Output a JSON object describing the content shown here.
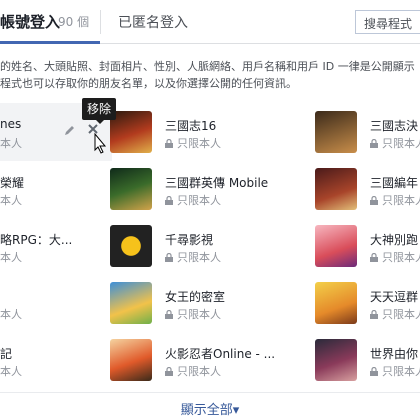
{
  "tabs": {
    "active_label": "帳號登入",
    "active_count": "90 個",
    "anonymous_label": "已匿名登入",
    "search_placeholder": "搜尋程式"
  },
  "description": {
    "line1": "的姓名、大頭貼照、封面相片、性別、人脈網絡、用戶名稱和用戶 ID 一律是公開顯示",
    "line2": "程式也可以存取你的朋友名單，以及你選擇公開的任何資訊。"
  },
  "tooltip": {
    "remove": "移除"
  },
  "apps": [
    {
      "name": "nes",
      "privacy": "本人"
    },
    {
      "name": "三國志16",
      "privacy": "只限本人"
    },
    {
      "name": "三國志決",
      "privacy": "只限本人"
    },
    {
      "name": "榮耀",
      "privacy": "本人"
    },
    {
      "name": "三國群英傳 Mobile",
      "privacy": "只限本人"
    },
    {
      "name": "三國編年",
      "privacy": "只限本人"
    },
    {
      "name": "略RPG：大...",
      "privacy": "本人"
    },
    {
      "name": "千尋影視",
      "privacy": "只限本人"
    },
    {
      "name": "大神別跑",
      "privacy": "只限本人"
    },
    {
      "name": "",
      "privacy": "本人"
    },
    {
      "name": "女王的密室",
      "privacy": "只限本人"
    },
    {
      "name": "天天逗群",
      "privacy": "只限本人"
    },
    {
      "name": "記",
      "privacy": "本人"
    },
    {
      "name": "火影忍者Online - ...",
      "privacy": "只限本人"
    },
    {
      "name": "世界由你",
      "privacy": "只限本人"
    }
  ],
  "footer": {
    "show_all": "顯示全部▾"
  },
  "colors": {
    "accent": "#4267b2",
    "link": "#365899",
    "muted": "#90949c"
  }
}
